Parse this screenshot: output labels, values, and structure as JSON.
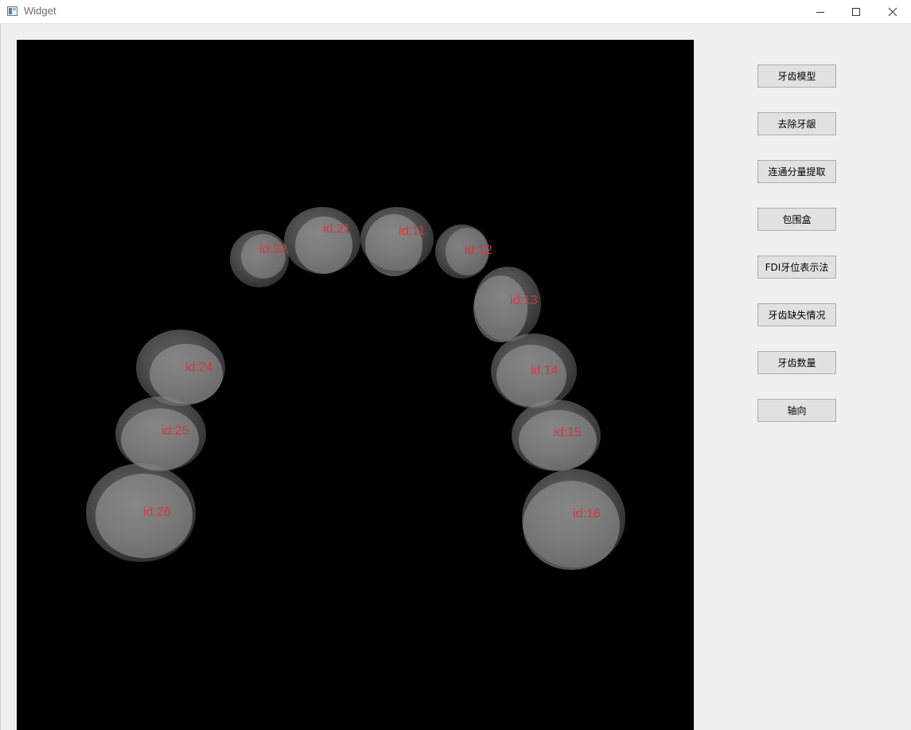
{
  "window": {
    "title": "Widget",
    "controls": [
      "minimize",
      "maximize",
      "close"
    ]
  },
  "viewport": {
    "background": "#000000",
    "label_color": "#d8363b",
    "teeth": [
      {
        "label": "id:22"
      },
      {
        "label": "id:21"
      },
      {
        "label": "id:11"
      },
      {
        "label": "id:12"
      },
      {
        "label": "id:13"
      },
      {
        "label": "id:24"
      },
      {
        "label": "id:14"
      },
      {
        "label": "id:25"
      },
      {
        "label": "id:15"
      },
      {
        "label": "id:26"
      },
      {
        "label": "id:16"
      }
    ]
  },
  "sidebar": {
    "buttons": [
      {
        "label": "牙齿模型"
      },
      {
        "label": "去除牙龈"
      },
      {
        "label": "连通分量提取"
      },
      {
        "label": "包围盒"
      },
      {
        "label": "FDI牙位表示法"
      },
      {
        "label": "牙齿缺失情况"
      },
      {
        "label": "牙齿数量"
      },
      {
        "label": "轴向"
      }
    ]
  }
}
